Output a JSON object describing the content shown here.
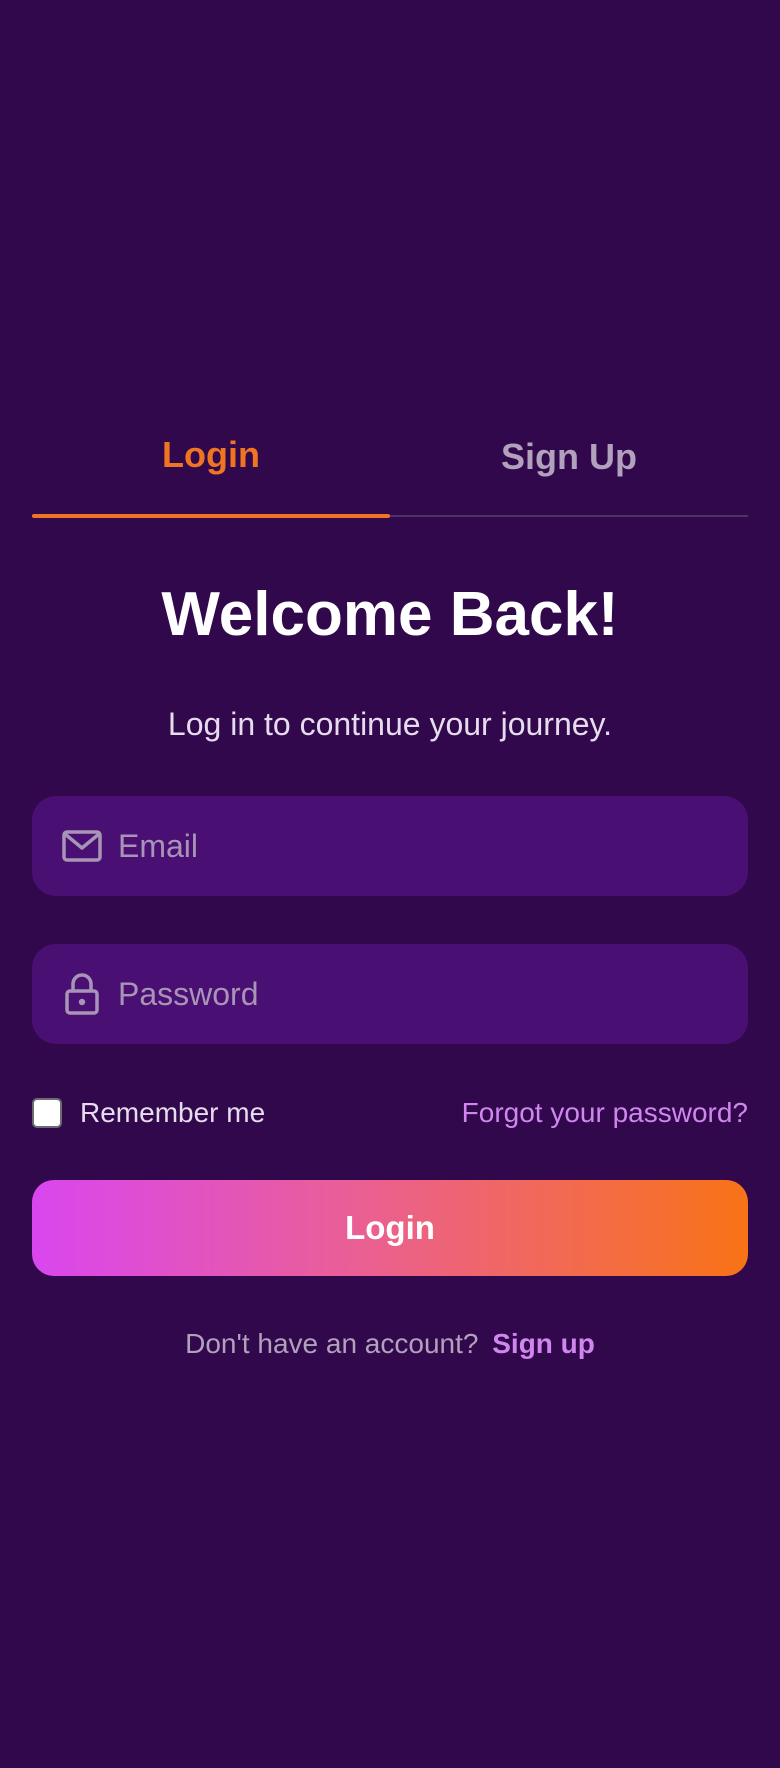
{
  "tabs": [
    {
      "label": "Login",
      "active": true
    },
    {
      "label": "Sign Up",
      "active": false
    }
  ],
  "heading": {
    "title": "Welcome Back!",
    "subtitle": "Log in to continue your journey."
  },
  "form": {
    "email": {
      "placeholder": "Email",
      "value": "",
      "icon": "mail-icon"
    },
    "password": {
      "placeholder": "Password",
      "value": "",
      "icon": "lock-icon"
    },
    "remember_label": "Remember me",
    "remember_checked": false,
    "forgot_link": "Forgot your password?",
    "submit_label": "Login"
  },
  "footer": {
    "prompt": "Don't have an account?",
    "link": "Sign up"
  },
  "colors": {
    "background": "#30084b",
    "field_background": "#4a0f72",
    "active_tab": "#f07523",
    "link": "#cf86ee",
    "button_gradient_start": "#d946ef",
    "button_gradient_end": "#f97316"
  }
}
